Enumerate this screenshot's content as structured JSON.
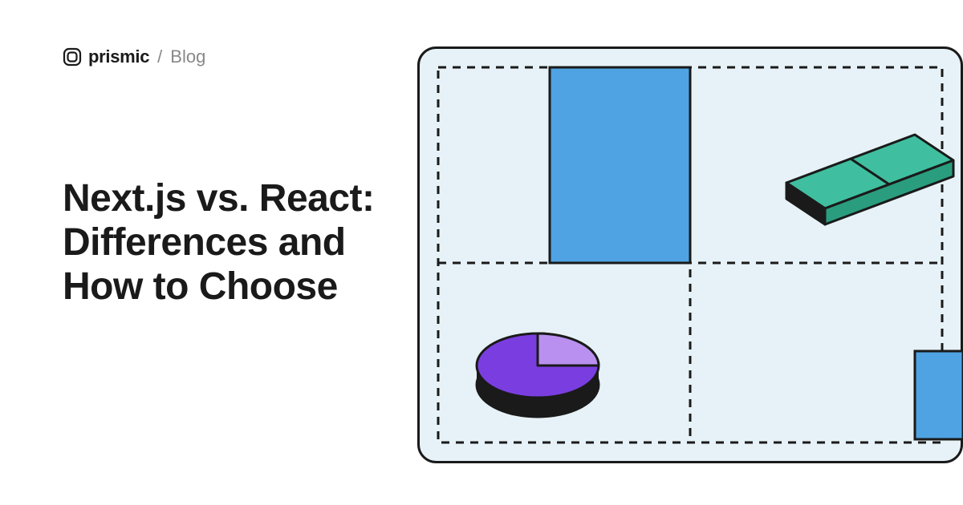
{
  "header": {
    "brand": "prismic",
    "separator": "/",
    "section": "Blog"
  },
  "title": "Next.js vs. React: Differences and How to Choose",
  "colors": {
    "bg_panel": "#e6f2f7",
    "blue_rect": "#4fa3e3",
    "green_book": "#3fbf9f",
    "purple_disc": "#7a3ee0",
    "purple_light": "#b990f0",
    "black": "#1a1a1a"
  }
}
